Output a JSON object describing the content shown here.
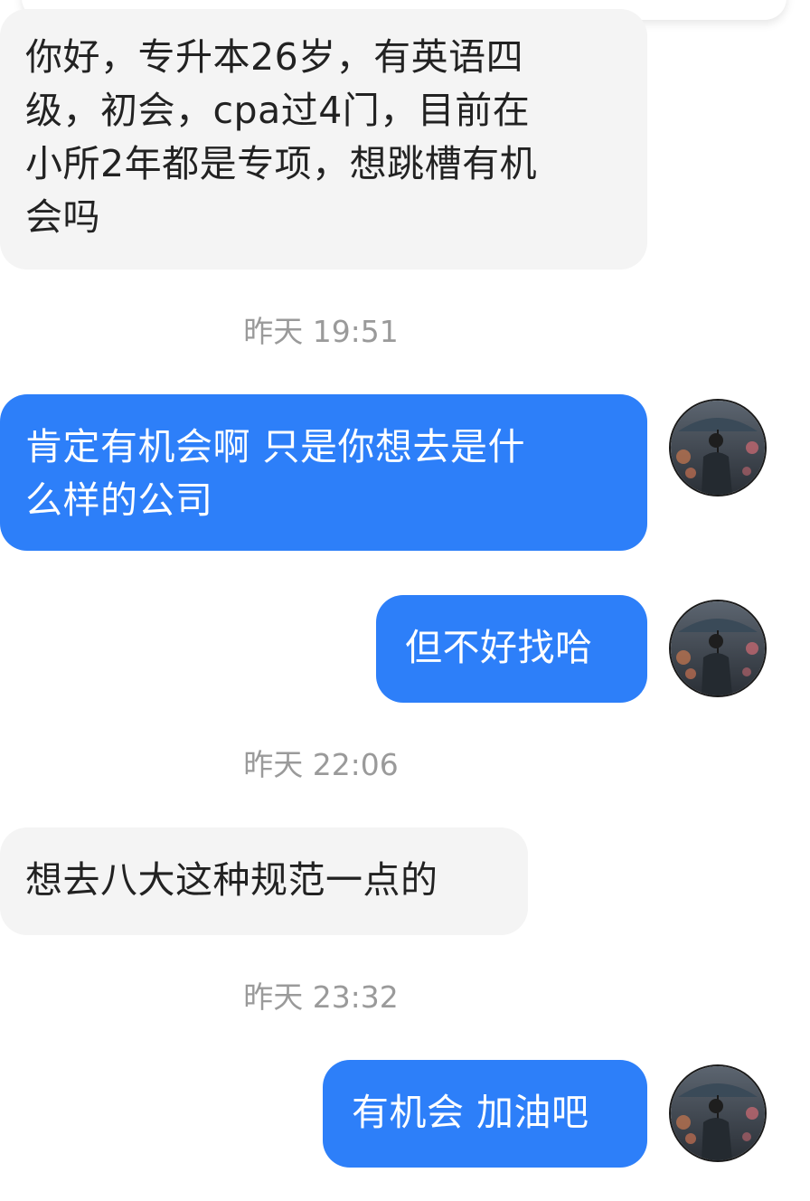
{
  "messages": [
    {
      "direction": "incoming",
      "lines": [
        "你好，专升本26岁，有英语四",
        "级，初会，cpa过4门，目前在",
        "小所2年都是专项，想跳槽有机",
        "会吗"
      ]
    },
    {
      "direction": "outgoing",
      "lines": [
        "肯定有机会啊 只是你想去是什",
        "么样的公司"
      ]
    },
    {
      "direction": "outgoing",
      "lines": [
        "但不好找哈"
      ]
    },
    {
      "direction": "incoming",
      "lines": [
        "想去八大这种规范一点的"
      ]
    },
    {
      "direction": "outgoing",
      "lines": [
        "有机会 加油吧"
      ]
    }
  ],
  "timestamps": [
    "昨天 19:51",
    "昨天 22:06",
    "昨天 23:32"
  ],
  "avatar_icon": "man-with-umbrella-avatar",
  "colors": {
    "outgoing_bubble": "#2d7ff9",
    "incoming_bubble": "#f4f4f4",
    "timestamp_text": "#9a9a9a"
  }
}
